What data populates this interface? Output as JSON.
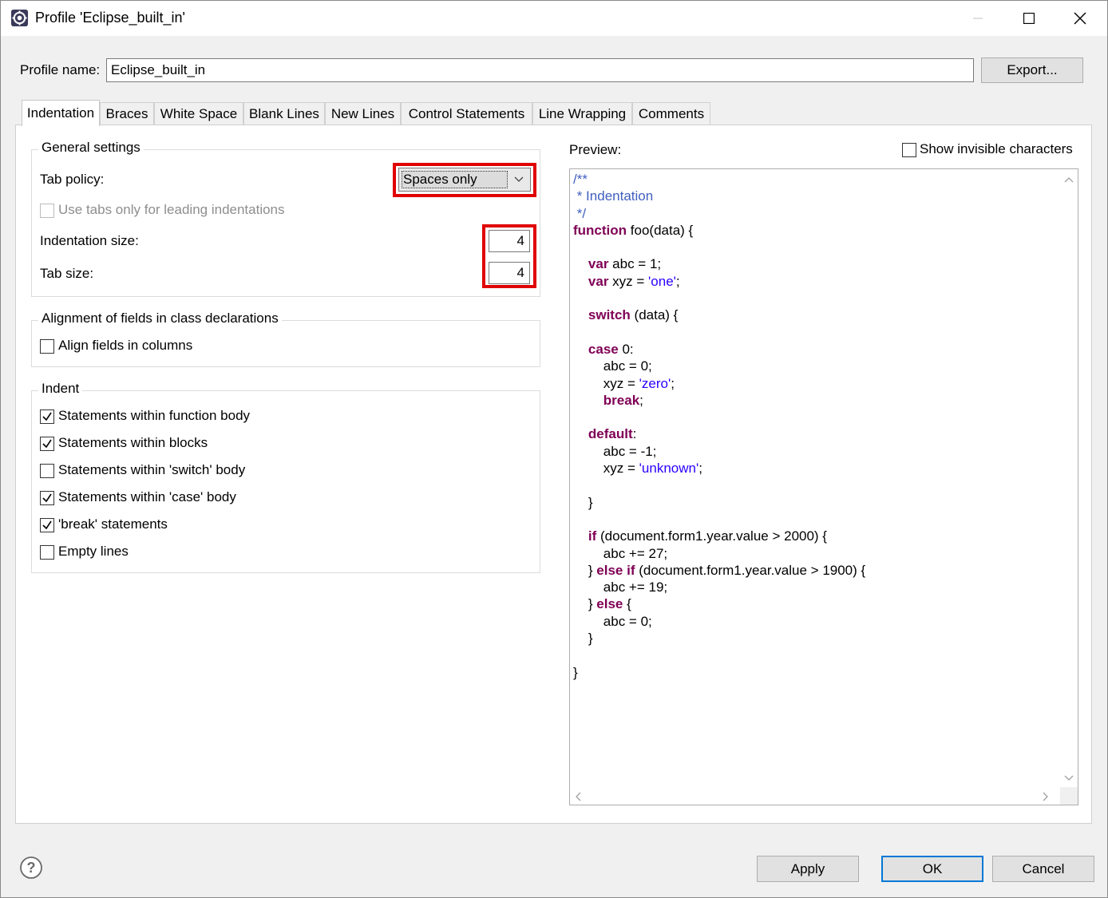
{
  "window": {
    "title": "Profile 'Eclipse_built_in'"
  },
  "profile": {
    "label": "Profile name:",
    "value": "Eclipse_built_in",
    "export_button": "Export..."
  },
  "tabs": [
    {
      "label": "Indentation",
      "active": true
    },
    {
      "label": "Braces"
    },
    {
      "label": "White Space"
    },
    {
      "label": "Blank Lines"
    },
    {
      "label": "New Lines"
    },
    {
      "label": "Control Statements"
    },
    {
      "label": "Line Wrapping"
    },
    {
      "label": "Comments"
    }
  ],
  "general": {
    "title": "General settings",
    "tab_policy_label": "Tab policy:",
    "tab_policy_value": "Spaces only",
    "use_tabs_label": "Use tabs only for leading indentations",
    "indent_size_label": "Indentation size:",
    "indent_size_value": "4",
    "tab_size_label": "Tab size:",
    "tab_size_value": "4"
  },
  "alignment": {
    "title": "Alignment of fields in class declarations",
    "align_label": "Align fields in columns"
  },
  "indent": {
    "title": "Indent",
    "items": [
      {
        "label": "Statements within function body",
        "checked": true
      },
      {
        "label": "Statements within blocks",
        "checked": true
      },
      {
        "label": "Statements within 'switch' body",
        "checked": false
      },
      {
        "label": "Statements within 'case' body",
        "checked": true
      },
      {
        "label": "'break' statements",
        "checked": true
      },
      {
        "label": "Empty lines",
        "checked": false
      }
    ]
  },
  "preview": {
    "label": "Preview:",
    "show_invisible_label": "Show invisible characters"
  },
  "buttons": {
    "apply": "Apply",
    "ok": "OK",
    "cancel": "Cancel"
  },
  "icons": {
    "app": "eclipse-gear-icon",
    "help": "help-icon",
    "dropdown": "chevron-down-icon"
  },
  "colors": {
    "keyword": "#7f0055",
    "string": "#2a00ff",
    "comment": "#3f5fbf",
    "highlight": "#e00000",
    "default_button": "#0078d7"
  }
}
